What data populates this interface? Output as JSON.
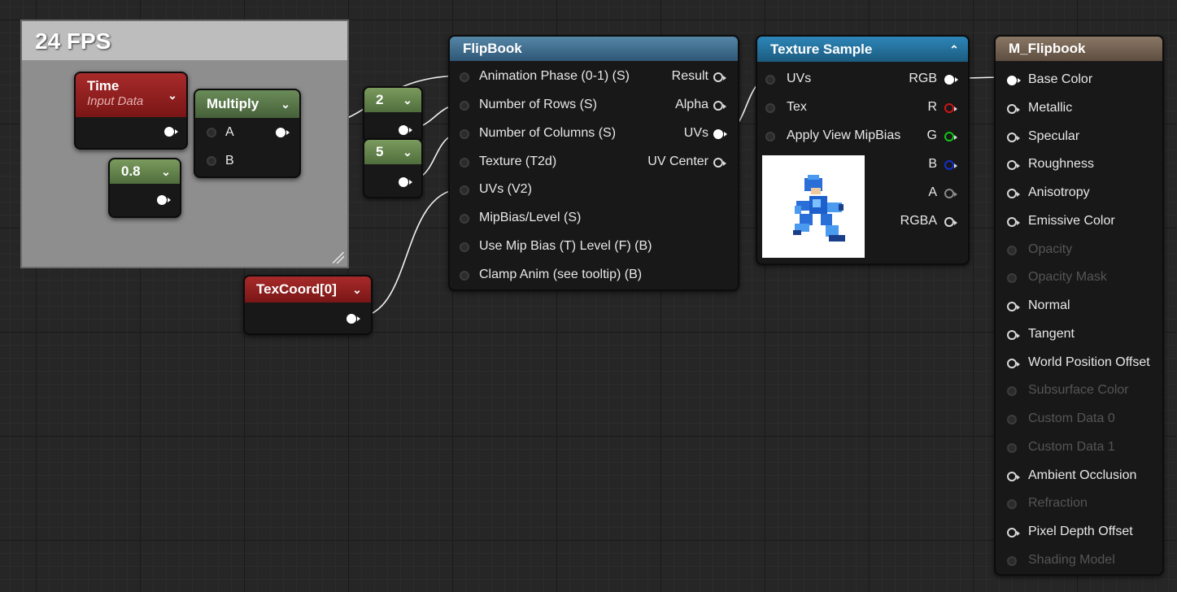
{
  "comment": {
    "title": "24 FPS"
  },
  "nodes": {
    "time": {
      "title": "Time",
      "subtitle": "Input Data"
    },
    "multiply": {
      "title": "Multiply",
      "inputs": [
        "A",
        "B"
      ]
    },
    "const_08": {
      "value": "0.8"
    },
    "const_2": {
      "value": "2"
    },
    "const_5": {
      "value": "5"
    },
    "texcoord": {
      "title": "TexCoord[0]"
    },
    "flipbook": {
      "title": "FlipBook",
      "inputs": [
        "Animation  Phase (0-1) (S)",
        "Number of Rows (S)",
        "Number of Columns (S)",
        "Texture (T2d)",
        "UVs (V2)",
        "MipBias/Level (S)",
        "Use Mip Bias (T) Level (F) (B)",
        "Clamp Anim (see tooltip) (B)"
      ],
      "outputs": [
        "Result",
        "Alpha",
        "UVs",
        "UV Center"
      ]
    },
    "texture_sample": {
      "title": "Texture Sample",
      "inputs": [
        "UVs",
        "Tex",
        "Apply View MipBias"
      ],
      "outputs": [
        "RGB",
        "R",
        "G",
        "B",
        "A",
        "RGBA"
      ],
      "output_colors": [
        "#ffffff",
        "#d01515",
        "#15c515",
        "#1530d0",
        "#8a8a8a",
        "#d8d8d8"
      ]
    },
    "material": {
      "title": "M_Flipbook",
      "inputs": [
        "Base Color",
        "Metallic",
        "Specular",
        "Roughness",
        "Anisotropy",
        "Emissive Color",
        "Opacity",
        "Opacity Mask",
        "Normal",
        "Tangent",
        "World Position Offset",
        "Subsurface Color",
        "Custom Data 0",
        "Custom Data 1",
        "Ambient Occlusion",
        "Refraction",
        "Pixel Depth Offset",
        "Shading Model"
      ],
      "enabled": [
        true,
        true,
        true,
        true,
        true,
        true,
        false,
        false,
        true,
        true,
        true,
        false,
        false,
        false,
        true,
        false,
        true,
        false
      ]
    }
  },
  "icons": {
    "collapse": "chevron-down-icon",
    "expand": "chevron-up-icon"
  }
}
